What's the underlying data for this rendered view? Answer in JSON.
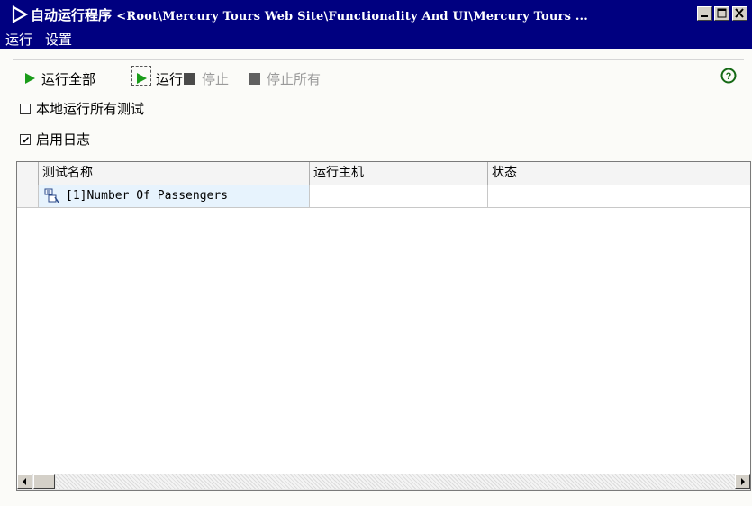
{
  "window": {
    "title": "自动运行程序",
    "path": "<Root\\Mercury Tours Web Site\\Functionality And UI\\Mercury Tours ...",
    "icon": "play-icon"
  },
  "menu": {
    "items": [
      {
        "label": "运行"
      },
      {
        "label": "设置"
      }
    ]
  },
  "toolbar": {
    "run_all_label": "运行全部",
    "run_label": "运行",
    "stop_label": "停止",
    "stop_all_label": "停止所有",
    "help_icon": "help-icon"
  },
  "options": {
    "run_local_label": "本地运行所有测试",
    "run_local_checked": false,
    "enable_log_label": "启用日志",
    "enable_log_checked": true
  },
  "table": {
    "columns": [
      "测试名称",
      "运行主机",
      "状态"
    ],
    "rows": [
      {
        "name": "[1]Number Of Passengers",
        "host": "",
        "status": "",
        "icon": "test-icon"
      }
    ]
  },
  "colors": {
    "titlebar": "#000080",
    "play_green": "#1a9c1a",
    "selected_row": "#e7f3fd"
  }
}
